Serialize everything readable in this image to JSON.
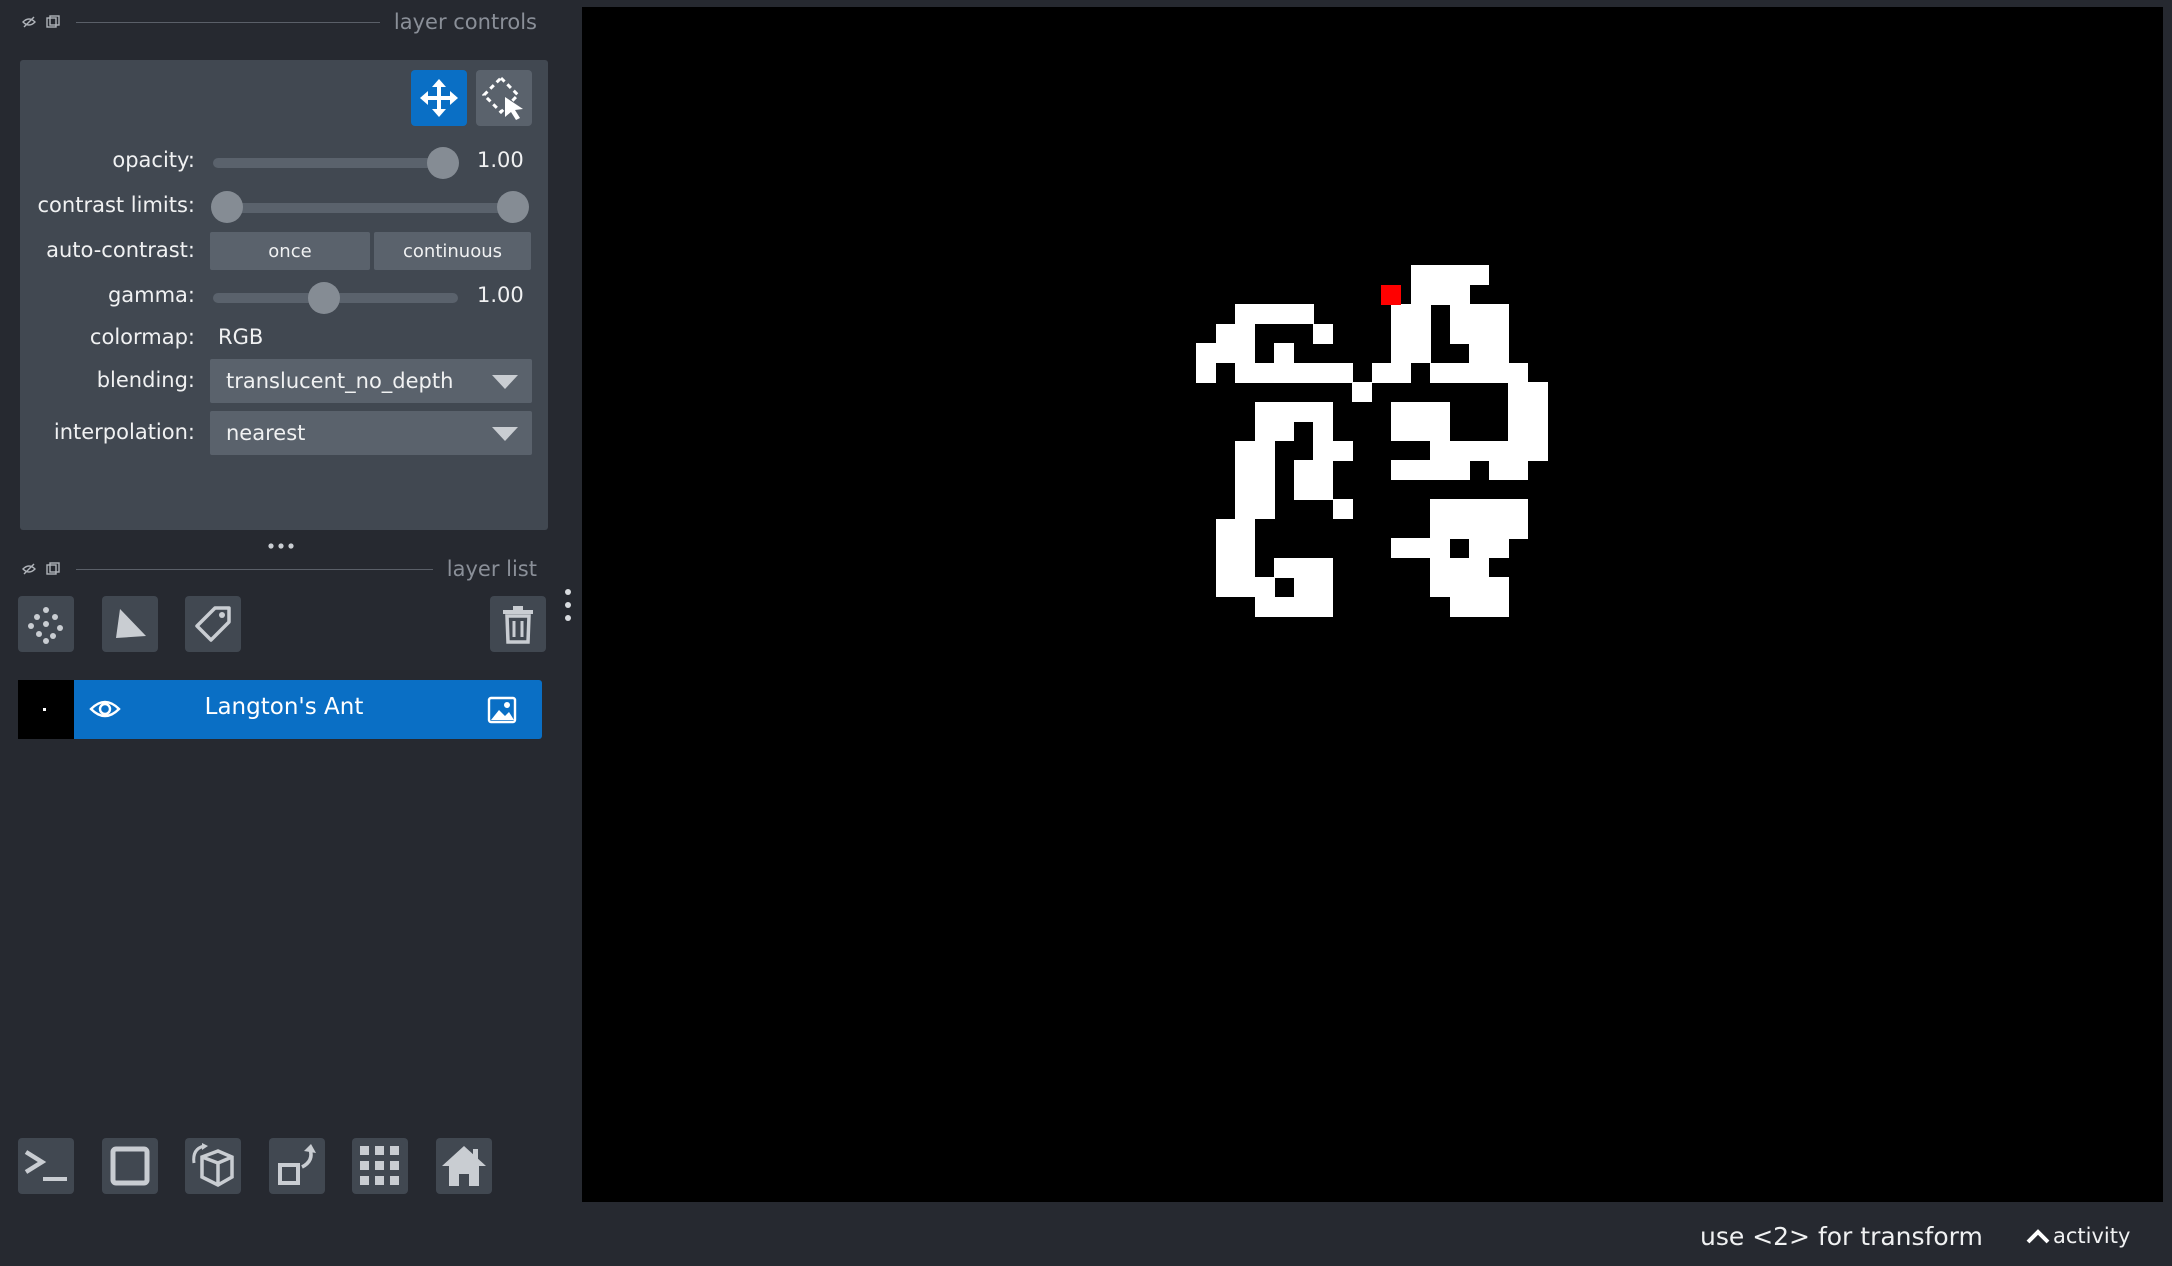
{
  "layer_controls": {
    "title": "layer controls",
    "opacity": {
      "label": "opacity:",
      "value": "1.00",
      "level": 1.0
    },
    "contrast_limits": {
      "label": "contrast limits:",
      "low": 0.0,
      "high": 1.0
    },
    "auto_contrast": {
      "label": "auto-contrast:",
      "once": "once",
      "continuous": "continuous"
    },
    "gamma": {
      "label": "gamma:",
      "value": "1.00"
    },
    "colormap": {
      "label": "colormap:",
      "value": "RGB"
    },
    "blending": {
      "label": "blending:",
      "value": "translucent_no_depth"
    },
    "interpolation": {
      "label": "interpolation:",
      "value": "nearest"
    }
  },
  "layer_list": {
    "title": "layer list",
    "layers": [
      {
        "name": "Langton's Ant",
        "visible": true,
        "selected": true
      }
    ]
  },
  "status": {
    "message": "use <2> for transform",
    "activity_label": "activity"
  },
  "colors": {
    "background": "#262930",
    "panel": "#414851",
    "accent": "#0a6fc5",
    "canvas": "#000000",
    "ant": "#ff0000"
  },
  "icons": [
    "visibility-toggle-icon",
    "float-icon",
    "pan-zoom-icon",
    "transform-icon",
    "points-icon",
    "shapes-icon",
    "labels-icon",
    "delete-icon",
    "eye-icon",
    "image-type-icon",
    "console-icon",
    "ndisplay-icon",
    "roll-icon",
    "transpose-icon",
    "grid-icon",
    "home-icon",
    "caret-up-icon"
  ]
}
